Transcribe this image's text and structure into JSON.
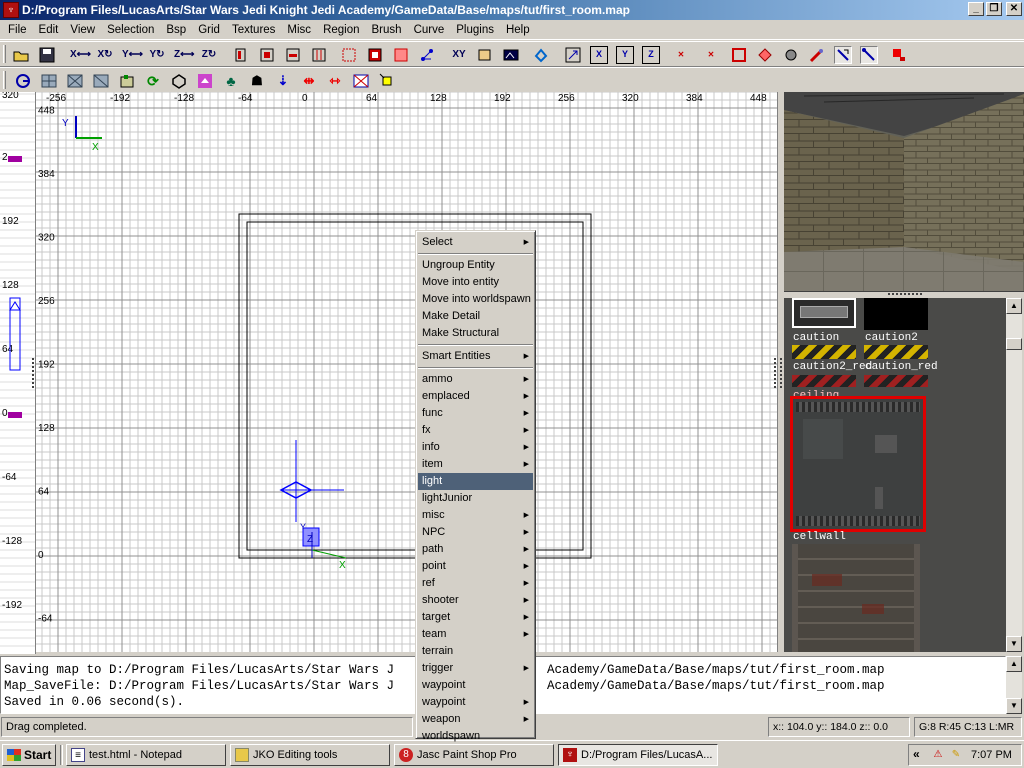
{
  "window": {
    "title": "D:/Program Files/LucasArts/Star Wars Jedi Knight Jedi Academy/GameData/Base/maps/tut/first_room.map",
    "app_icon": "radiant-icon",
    "buttons": [
      "_",
      "❐",
      "✕"
    ]
  },
  "menu": [
    "File",
    "Edit",
    "View",
    "Selection",
    "Bsp",
    "Grid",
    "Textures",
    "Misc",
    "Region",
    "Brush",
    "Curve",
    "Plugins",
    "Help"
  ],
  "toolbar1": {
    "buttons": [
      "open-icon",
      "save-icon",
      "flip-x-icon",
      "rotate-x-icon",
      "flip-y-icon",
      "rotate-y-icon",
      "flip-z-icon",
      "rotate-z-icon",
      "brush-cleanup-icon",
      "csg-subtract-icon",
      "csg-merge-icon",
      "hollow-icon",
      "vertex-edit-icon",
      "select-inside-icon",
      "select-touching-icon",
      "change-views-icon",
      "texture-lock-icon",
      "scale-icon",
      "camera-icon",
      "cube-icon",
      "view-x-icon",
      "view-y-icon",
      "view-z-icon",
      "hide-models-icon",
      "hide-paths-icon",
      "hide-brushes-icon",
      "entities-icon",
      "patch-icon",
      "light-icon",
      "grid-snap-icon",
      "clipper-icon",
      "red-brush-icon"
    ],
    "view_labels": [
      "X",
      "Y",
      "Z"
    ]
  },
  "toolbar2": {
    "buttons": [
      "curve-icon",
      "patch-grid-icon",
      "patch-select-icon",
      "patch-cap-icon",
      "bevel-icon",
      "rotate-patch-icon",
      "cone-icon",
      "texture-icon",
      "tree-icon",
      "entity-icon",
      "drop-icon",
      "mirror-icon",
      "mirror-v-icon",
      "show-faces-icon",
      "select-ent-icon"
    ]
  },
  "grid": {
    "top_ruler": [
      "-256",
      "-192",
      "-128",
      "-64",
      "0",
      "64",
      "128",
      "192",
      "256",
      "320",
      "384",
      "448"
    ],
    "left_ruler": [
      "448",
      "384",
      "320",
      "256",
      "192",
      "128",
      "64",
      "0",
      "-64"
    ],
    "axis_top_left": {
      "y": "Y",
      "x": "X"
    },
    "far_left_ruler": [
      "320",
      "2",
      "192",
      "128",
      "64",
      "0",
      "-64",
      "-128",
      "-192"
    ],
    "entity_labels": {
      "y": "Y",
      "z": "Z",
      "x": "X"
    }
  },
  "textures": {
    "items": [
      "caution",
      "caution2",
      "caution2_red",
      "caution_red",
      "ceiling",
      "cellwall"
    ],
    "selected": "ceiling"
  },
  "console": [
    "Saving map to D:/Program Files/LucasArts/Star Wars J",
    "Map_SaveFile: D:/Program Files/LucasArts/Star Wars J",
    "Saved in 0.06 second(s)."
  ],
  "console_tail": [
    "Academy/GameData/Base/maps/tut/first_room.map",
    "Academy/GameData/Base/maps/tut/first_room.map"
  ],
  "status": {
    "message": "Drag completed.",
    "coords": "x:: 104.0  y:: 184.0  z:: 0.0",
    "grid": "G:8 R:45 C:13 L:MR"
  },
  "context_menu": {
    "items": [
      {
        "label": "Select",
        "sub": true
      },
      {
        "sep": true
      },
      {
        "label": "Ungroup Entity"
      },
      {
        "label": "Move into entity"
      },
      {
        "label": "Move into worldspawn"
      },
      {
        "label": "Make Detail"
      },
      {
        "label": "Make Structural"
      },
      {
        "sep": true
      },
      {
        "label": "Smart Entities",
        "sub": true
      },
      {
        "sep": true
      },
      {
        "label": "ammo",
        "sub": true
      },
      {
        "label": "emplaced",
        "sub": true
      },
      {
        "label": "func",
        "sub": true
      },
      {
        "label": "fx",
        "sub": true
      },
      {
        "label": "info",
        "sub": true
      },
      {
        "label": "item",
        "sub": true
      },
      {
        "label": "light",
        "highlight": true
      },
      {
        "label": "lightJunior"
      },
      {
        "label": "misc",
        "sub": true
      },
      {
        "label": "NPC",
        "sub": true
      },
      {
        "label": "path",
        "sub": true
      },
      {
        "label": "point",
        "sub": true
      },
      {
        "label": "ref",
        "sub": true
      },
      {
        "label": "shooter",
        "sub": true
      },
      {
        "label": "target",
        "sub": true
      },
      {
        "label": "team",
        "sub": true
      },
      {
        "label": "terrain"
      },
      {
        "label": "trigger",
        "sub": true
      },
      {
        "label": "waypoint"
      },
      {
        "label": "waypoint",
        "sub": true
      },
      {
        "label": "weapon",
        "sub": true
      },
      {
        "label": "worldspawn"
      }
    ],
    "submenu_arrow": "▶"
  },
  "taskbar": {
    "start": "Start",
    "tasks": [
      {
        "label": "test.html - Notepad",
        "icon": "notepad-icon"
      },
      {
        "label": "JKO Editing tools",
        "icon": "folder-icon"
      },
      {
        "label": "Jasc Paint Shop Pro",
        "icon": "psp-icon"
      },
      {
        "label": "D:/Program Files/LucasA...",
        "icon": "radiant-icon",
        "active": true
      }
    ],
    "tray_arrow": "«",
    "clock": "7:07 PM"
  },
  "colors": {
    "title_start": "#0a246a",
    "title_end": "#a6caf0",
    "menu_highlight": "#4e6178",
    "texture_selection": "#e00000",
    "grid_line": "#c8c8c8",
    "grid_major": "#909090",
    "brush_line": "#000000",
    "entity_blue": "#0000ff",
    "axis_green": "#00a000"
  }
}
